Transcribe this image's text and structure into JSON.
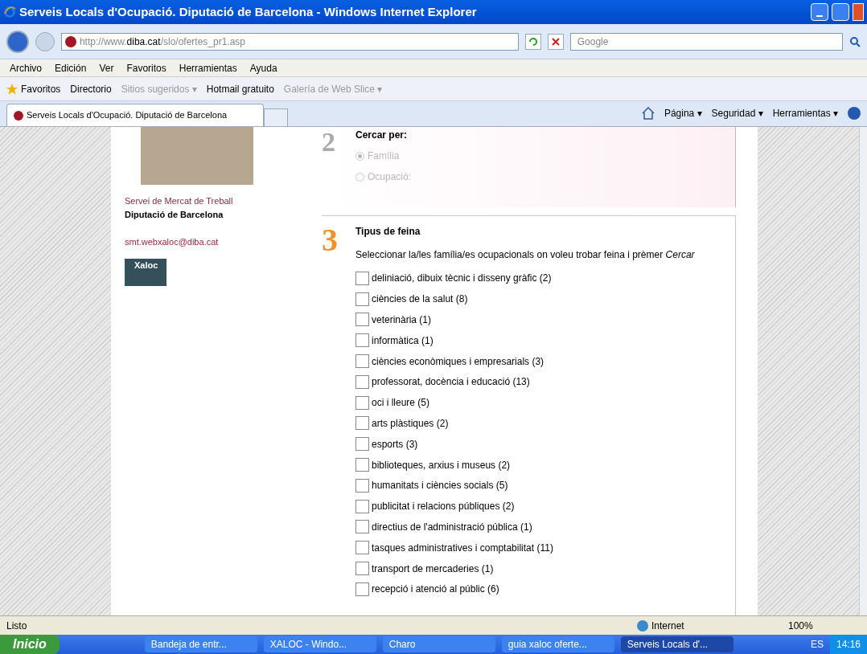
{
  "window": {
    "title": "Serveis Locals d'Ocupació. Diputació de Barcelona - Windows Internet Explorer"
  },
  "address": {
    "prefix": "http://www.",
    "domain": "diba.cat",
    "path": "/slo/ofertes_pr1.asp"
  },
  "search": {
    "placeholder": "Google"
  },
  "menu": [
    "Archivo",
    "Edición",
    "Ver",
    "Favoritos",
    "Herramientas",
    "Ayuda"
  ],
  "favorites_bar": {
    "label": "Favoritos",
    "links": [
      {
        "label": "Directorio",
        "disabled": false
      },
      {
        "label": "Sitios sugeridos ▾",
        "disabled": true
      },
      {
        "label": "Hotmail gratuito",
        "disabled": false
      },
      {
        "label": "Galería de Web Slice ▾",
        "disabled": true
      }
    ]
  },
  "tab": {
    "label": "Serveis Locals d'Ocupació. Diputació de Barcelona"
  },
  "command_bar": [
    "Página ▾",
    "Seguridad ▾",
    "Herramientas ▾"
  ],
  "sidebar": {
    "org_line1": "Servei de Mercat de Treball",
    "org_line2": "Diputació de Barcelona",
    "email": "smt.webxaloc@diba.cat",
    "logo": "Xaloc"
  },
  "step2": {
    "number": "2",
    "title": "Cercar per:",
    "options": [
      {
        "label": "Família",
        "selected": true,
        "disabled": true
      },
      {
        "label": "Ocupació:",
        "selected": false,
        "disabled": true
      }
    ]
  },
  "step3": {
    "number": "3",
    "title": "Tipus de feina",
    "instruction": "Seleccionar la/les família/es ocupacionals on voleu trobar feina i prèmer *Cercar*",
    "options": [
      {
        "label": "deliniació, dibuix tècnic i disseny gràfic (2)",
        "checked": false
      },
      {
        "label": "ciències de la salut (8)",
        "checked": false
      },
      {
        "label": "veterinària (1)",
        "checked": false
      },
      {
        "label": "informàtica (1)",
        "checked": false
      },
      {
        "label": "ciències econòmiques i empresarials (3)",
        "checked": false
      },
      {
        "label": "professorat, docència i educació (13)",
        "checked": false
      },
      {
        "label": "oci i lleure (5)",
        "checked": false
      },
      {
        "label": "arts plàstiques (2)",
        "checked": false
      },
      {
        "label": "esports (3)",
        "checked": false
      },
      {
        "label": "biblioteques, arxius i museus (2)",
        "checked": false
      },
      {
        "label": "humanitats i ciències socials (5)",
        "checked": false
      },
      {
        "label": "publicitat i relacions públiques (2)",
        "checked": false
      },
      {
        "label": "directius de l'administració pública (1)",
        "checked": false
      },
      {
        "label": "tasques administratives i comptabilitat (11)",
        "checked": false
      },
      {
        "label": "transport de mercaderies (1)",
        "checked": false
      },
      {
        "label": "recepció i atenció al públic (6)",
        "checked": false
      }
    ]
  },
  "status_bar": {
    "text": "Listo",
    "zone": "Internet",
    "zoom": "100%"
  },
  "taskbar": {
    "start": "Inicio",
    "items": [
      {
        "label": "Bandeja de entr...",
        "selected": false
      },
      {
        "label": "XALOC - Windo...",
        "selected": false
      },
      {
        "label": "Charo",
        "selected": false
      },
      {
        "label": "guia xaloc oferte...",
        "selected": false
      },
      {
        "label": "Serveis Locals d'...",
        "selected": true
      }
    ],
    "language": "ES",
    "clock": "14:16"
  }
}
